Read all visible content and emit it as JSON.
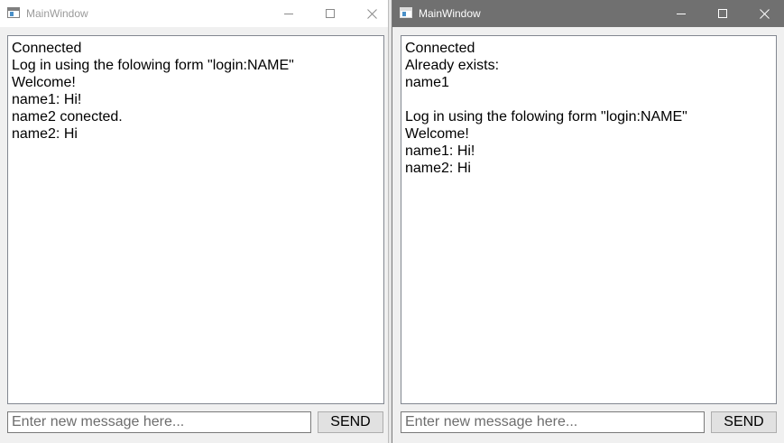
{
  "windows": [
    {
      "title": "MainWindow",
      "chat_lines": [
        "Connected",
        "Log in using the folowing form \"login:NAME\"",
        "Welcome!",
        "name1: Hi!",
        "name2 conected.",
        "name2: Hi"
      ],
      "input_placeholder": "Enter new message here...",
      "input_value": "",
      "send_label": "SEND"
    },
    {
      "title": "MainWindow",
      "chat_lines": [
        "Connected",
        "Already exists:",
        "name1",
        "",
        "Log in using the folowing form \"login:NAME\"",
        "Welcome!",
        "name1: Hi!",
        "name2: Hi"
      ],
      "input_placeholder": "Enter new message here...",
      "input_value": "",
      "send_label": "SEND"
    }
  ],
  "icons": {
    "app": "app-window-icon",
    "minimize": "minimize-icon",
    "maximize": "maximize-icon",
    "close": "close-icon"
  },
  "colors": {
    "inactive_titlebar": "#ffffff",
    "active_titlebar": "#707070",
    "window_bg": "#f0f0f0",
    "button_bg": "#e1e1e1"
  }
}
